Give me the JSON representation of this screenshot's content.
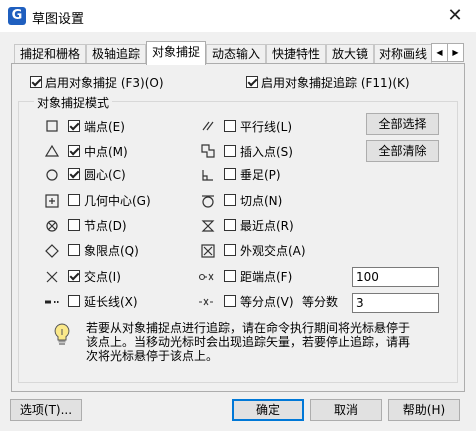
{
  "window": {
    "title": "草图设置",
    "app_icon_letter": "G",
    "close_glyph": "✕"
  },
  "tabs": [
    {
      "label": "捕捉和栅格",
      "active": false
    },
    {
      "label": "极轴追踪",
      "active": false
    },
    {
      "label": "对象捕捉",
      "active": true
    },
    {
      "label": "动态输入",
      "active": false
    },
    {
      "label": "快捷特性",
      "active": false
    },
    {
      "label": "放大镜",
      "active": false
    },
    {
      "label": "对称画线",
      "active": false
    }
  ],
  "tab_scroll": {
    "left": "◀",
    "right": "▶"
  },
  "top_options": {
    "enable_osnap": {
      "label": "启用对象捕捉 (F3)(O)",
      "checked": true
    },
    "enable_tracking": {
      "label": "启用对象捕捉追踪 (F11)(K)",
      "checked": true
    }
  },
  "group_title": "对象捕捉模式",
  "modes_left": [
    {
      "icon": "square-marker-icon",
      "label": "端点(E)",
      "checked": true
    },
    {
      "icon": "triangle-marker-icon",
      "label": "中点(M)",
      "checked": true
    },
    {
      "icon": "circle-marker-icon",
      "label": "圆心(C)",
      "checked": true
    },
    {
      "icon": "geometric-center-icon",
      "label": "几何中心(G)",
      "checked": false
    },
    {
      "icon": "node-marker-icon",
      "label": "节点(D)",
      "checked": false
    },
    {
      "icon": "diamond-marker-icon",
      "label": "象限点(Q)",
      "checked": false
    },
    {
      "icon": "x-marker-icon",
      "label": "交点(I)",
      "checked": true
    },
    {
      "icon": "extension-marker-icon",
      "label": "延长线(X)",
      "checked": false
    }
  ],
  "modes_right": [
    {
      "icon": "parallel-marker-icon",
      "label": "平行线(L)",
      "checked": false
    },
    {
      "icon": "insert-marker-icon",
      "label": "插入点(S)",
      "checked": false
    },
    {
      "icon": "perpendicular-marker-icon",
      "label": "垂足(P)",
      "checked": false
    },
    {
      "icon": "tangent-marker-icon",
      "label": "切点(N)",
      "checked": false
    },
    {
      "icon": "nearest-marker-icon",
      "label": "最近点(R)",
      "checked": false
    },
    {
      "icon": "apparent-intersection-icon",
      "label": "外观交点(A)",
      "checked": false
    },
    {
      "icon": "distance-point-icon",
      "label": "距端点(F)",
      "checked": false
    },
    {
      "icon": "divide-point-icon",
      "label": "等分点(V)",
      "checked": false
    }
  ],
  "buttons": {
    "select_all": "全部选择",
    "clear_all": "全部清除"
  },
  "distance_value": "100",
  "divide_label": "等分数",
  "divide_value": "3",
  "tip": "若要从对象捕捉点进行追踪，请在命令执行期间将光标悬停于该点上。当移动光标时会出现追踪矢量，若要停止追踪，请再次将光标悬停于该点上。",
  "footer": {
    "options": "选项(T)...",
    "ok": "确定",
    "cancel": "取消",
    "help": "帮助(H)"
  }
}
